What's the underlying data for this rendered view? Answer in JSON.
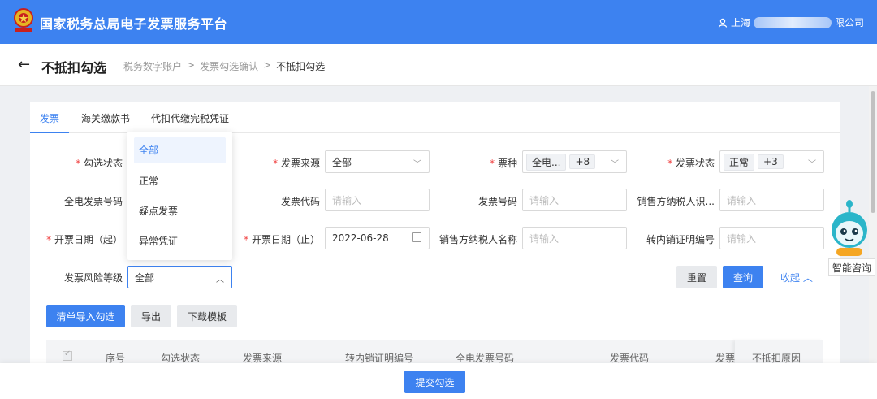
{
  "app": {
    "title": "国家税务总局电子发票服务平台",
    "user_prefix": "上海",
    "user_suffix": "限公司"
  },
  "header": {
    "back_icon": "←",
    "title": "不抵扣勾选",
    "breadcrumb": [
      "税务数字账户",
      "发票勾选确认",
      "不抵扣勾选"
    ],
    "separator": ">"
  },
  "tabs": [
    "发票",
    "海关缴款书",
    "代扣代缴完税凭证"
  ],
  "filters": {
    "check_status": {
      "label": "勾选状态"
    },
    "invoice_source": {
      "label": "发票来源",
      "value": "全部"
    },
    "ticket_type": {
      "label": "票种",
      "tag1": "全电...",
      "tag2": "+8"
    },
    "invoice_status": {
      "label": "发票状态",
      "tag1": "正常",
      "tag2": "+3"
    },
    "full_invoice_no": {
      "label": "全电发票号码"
    },
    "invoice_code": {
      "label": "发票代码",
      "placeholder": "请输入"
    },
    "invoice_no": {
      "label": "发票号码",
      "placeholder": "请输入"
    },
    "seller_tax_id": {
      "label": "销售方纳税人识...",
      "placeholder": "请输入"
    },
    "date_start": {
      "label": "开票日期（起）"
    },
    "date_end": {
      "label": "开票日期（止）",
      "value": "2022-06-28"
    },
    "seller_name": {
      "label": "销售方纳税人名称",
      "placeholder": "请输入"
    },
    "transfer_no": {
      "label": "转内销证明编号",
      "placeholder": "请输入"
    },
    "risk_level": {
      "label": "发票风险等级",
      "value": "全部"
    }
  },
  "dropdown": {
    "options": [
      "全部",
      "正常",
      "疑点发票",
      "异常凭证"
    ],
    "selected": "全部"
  },
  "buttons": {
    "reset": "重置",
    "query": "查询",
    "collapse": "收起",
    "import": "清单导入勾选",
    "export": "导出",
    "download": "下载模板",
    "submit": "提交勾选"
  },
  "table": {
    "columns": [
      "序号",
      "勾选状态",
      "发票来源",
      "转内销证明编号",
      "全电发票号码",
      "发票代码",
      "发票",
      "不抵扣原因"
    ]
  },
  "assistant": {
    "label": "智能咨询"
  },
  "colors": {
    "primary": "#3d82f0",
    "required": "#f04040"
  }
}
